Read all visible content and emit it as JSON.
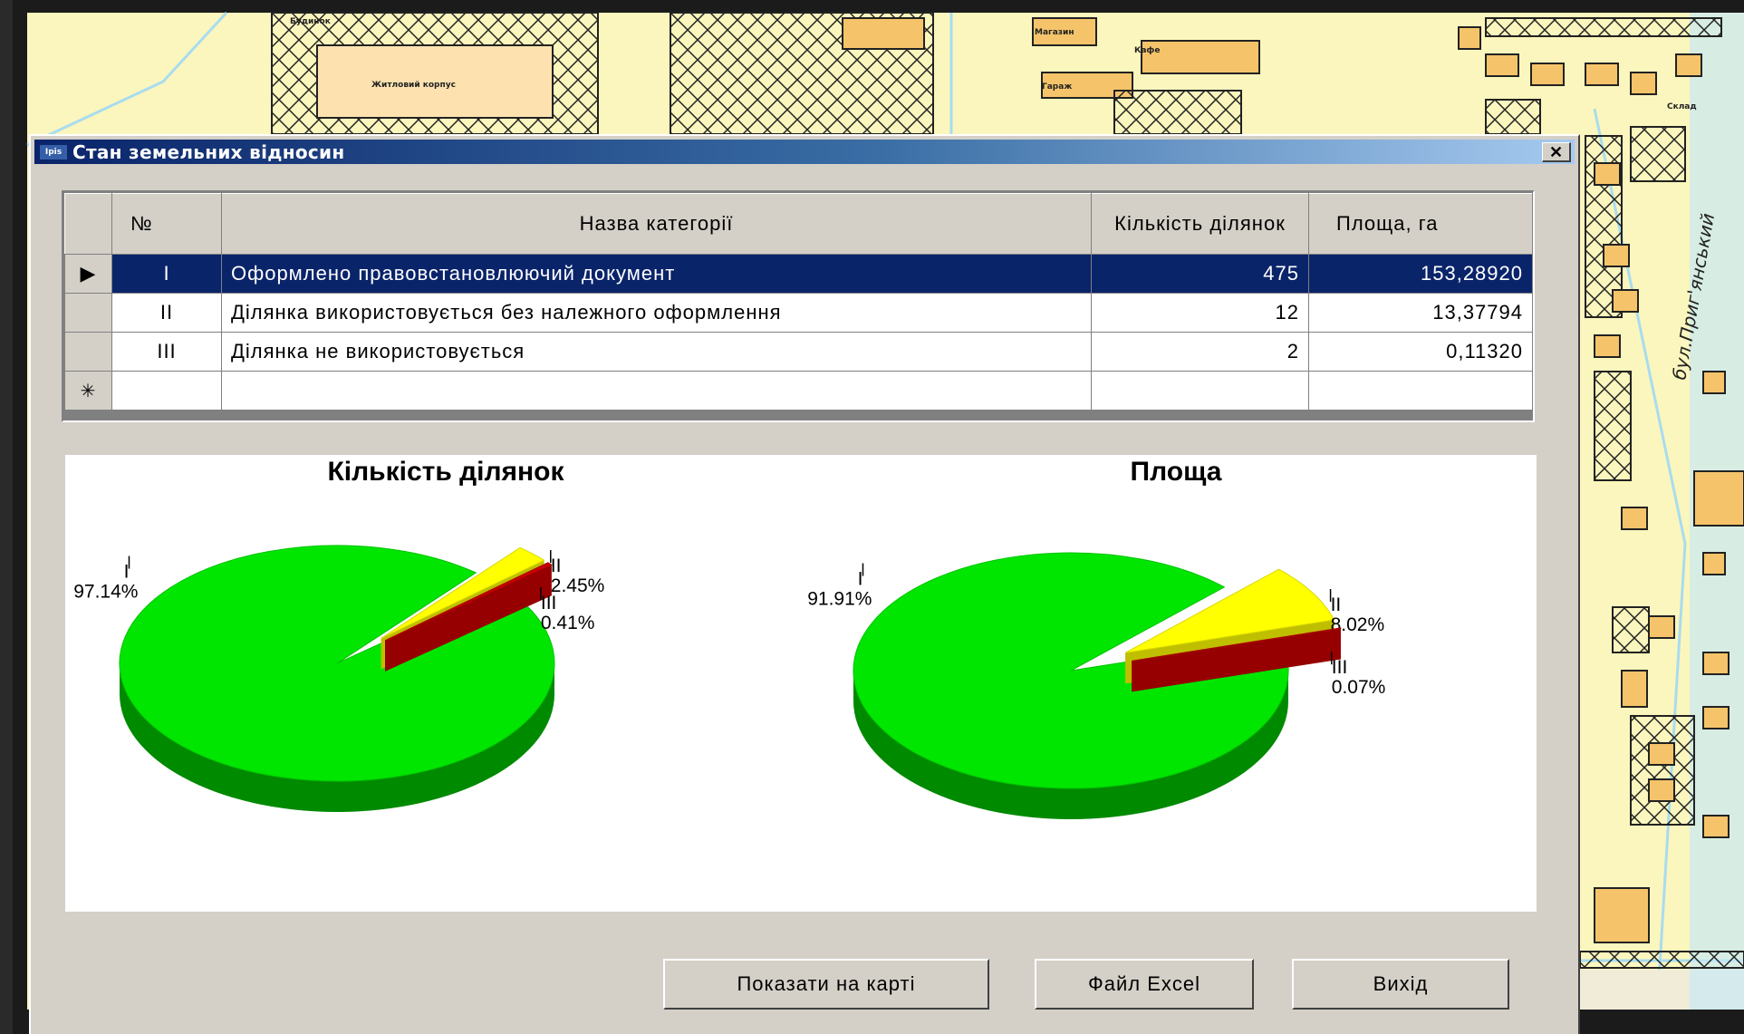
{
  "map": {
    "street_label": "бул.Приг'янський",
    "building_labels": [
      "Будинок",
      "Житловий корпус",
      "Магазин",
      "Кафе",
      "Гараж",
      "Склад"
    ]
  },
  "dialog": {
    "app_icon": "Ipis",
    "title": "Стан земельних відносин",
    "close_glyph": "✕"
  },
  "table": {
    "columns": [
      "№",
      "Назва категорії",
      "Кількість ділянок",
      "Площа, га"
    ],
    "rows": [
      {
        "indicator": "▶",
        "num": "I",
        "name": "Оформлено правовстановлюючий  документ",
        "count": "475",
        "area": "153,28920"
      },
      {
        "indicator": "",
        "num": "II",
        "name": "Ділянка використовується без належного оформлення",
        "count": "12",
        "area": "13,37794"
      },
      {
        "indicator": "",
        "num": "III",
        "name": "Ділянка не використовується",
        "count": "2",
        "area": "0,11320"
      }
    ],
    "new_row_indicator": "✳"
  },
  "chart_data": [
    {
      "type": "pie",
      "title": "Кількість ділянок",
      "categories": [
        "I",
        "II",
        "III"
      ],
      "values": [
        97.14,
        2.45,
        0.41
      ],
      "labels": [
        "97.14%",
        "2.45%",
        "0.41%"
      ],
      "colors": [
        "#00e600",
        "#ffff00",
        "#c80000"
      ]
    },
    {
      "type": "pie",
      "title": "Площа",
      "categories": [
        "I",
        "II",
        "III"
      ],
      "values": [
        91.91,
        8.02,
        0.07
      ],
      "labels": [
        "91.91%",
        "8.02%",
        "0.07%"
      ],
      "colors": [
        "#00e600",
        "#ffff00",
        "#c80000"
      ]
    }
  ],
  "buttons": {
    "show_on_map": "Показати на карті",
    "excel": "Файл Excel",
    "exit": "Вихід"
  }
}
